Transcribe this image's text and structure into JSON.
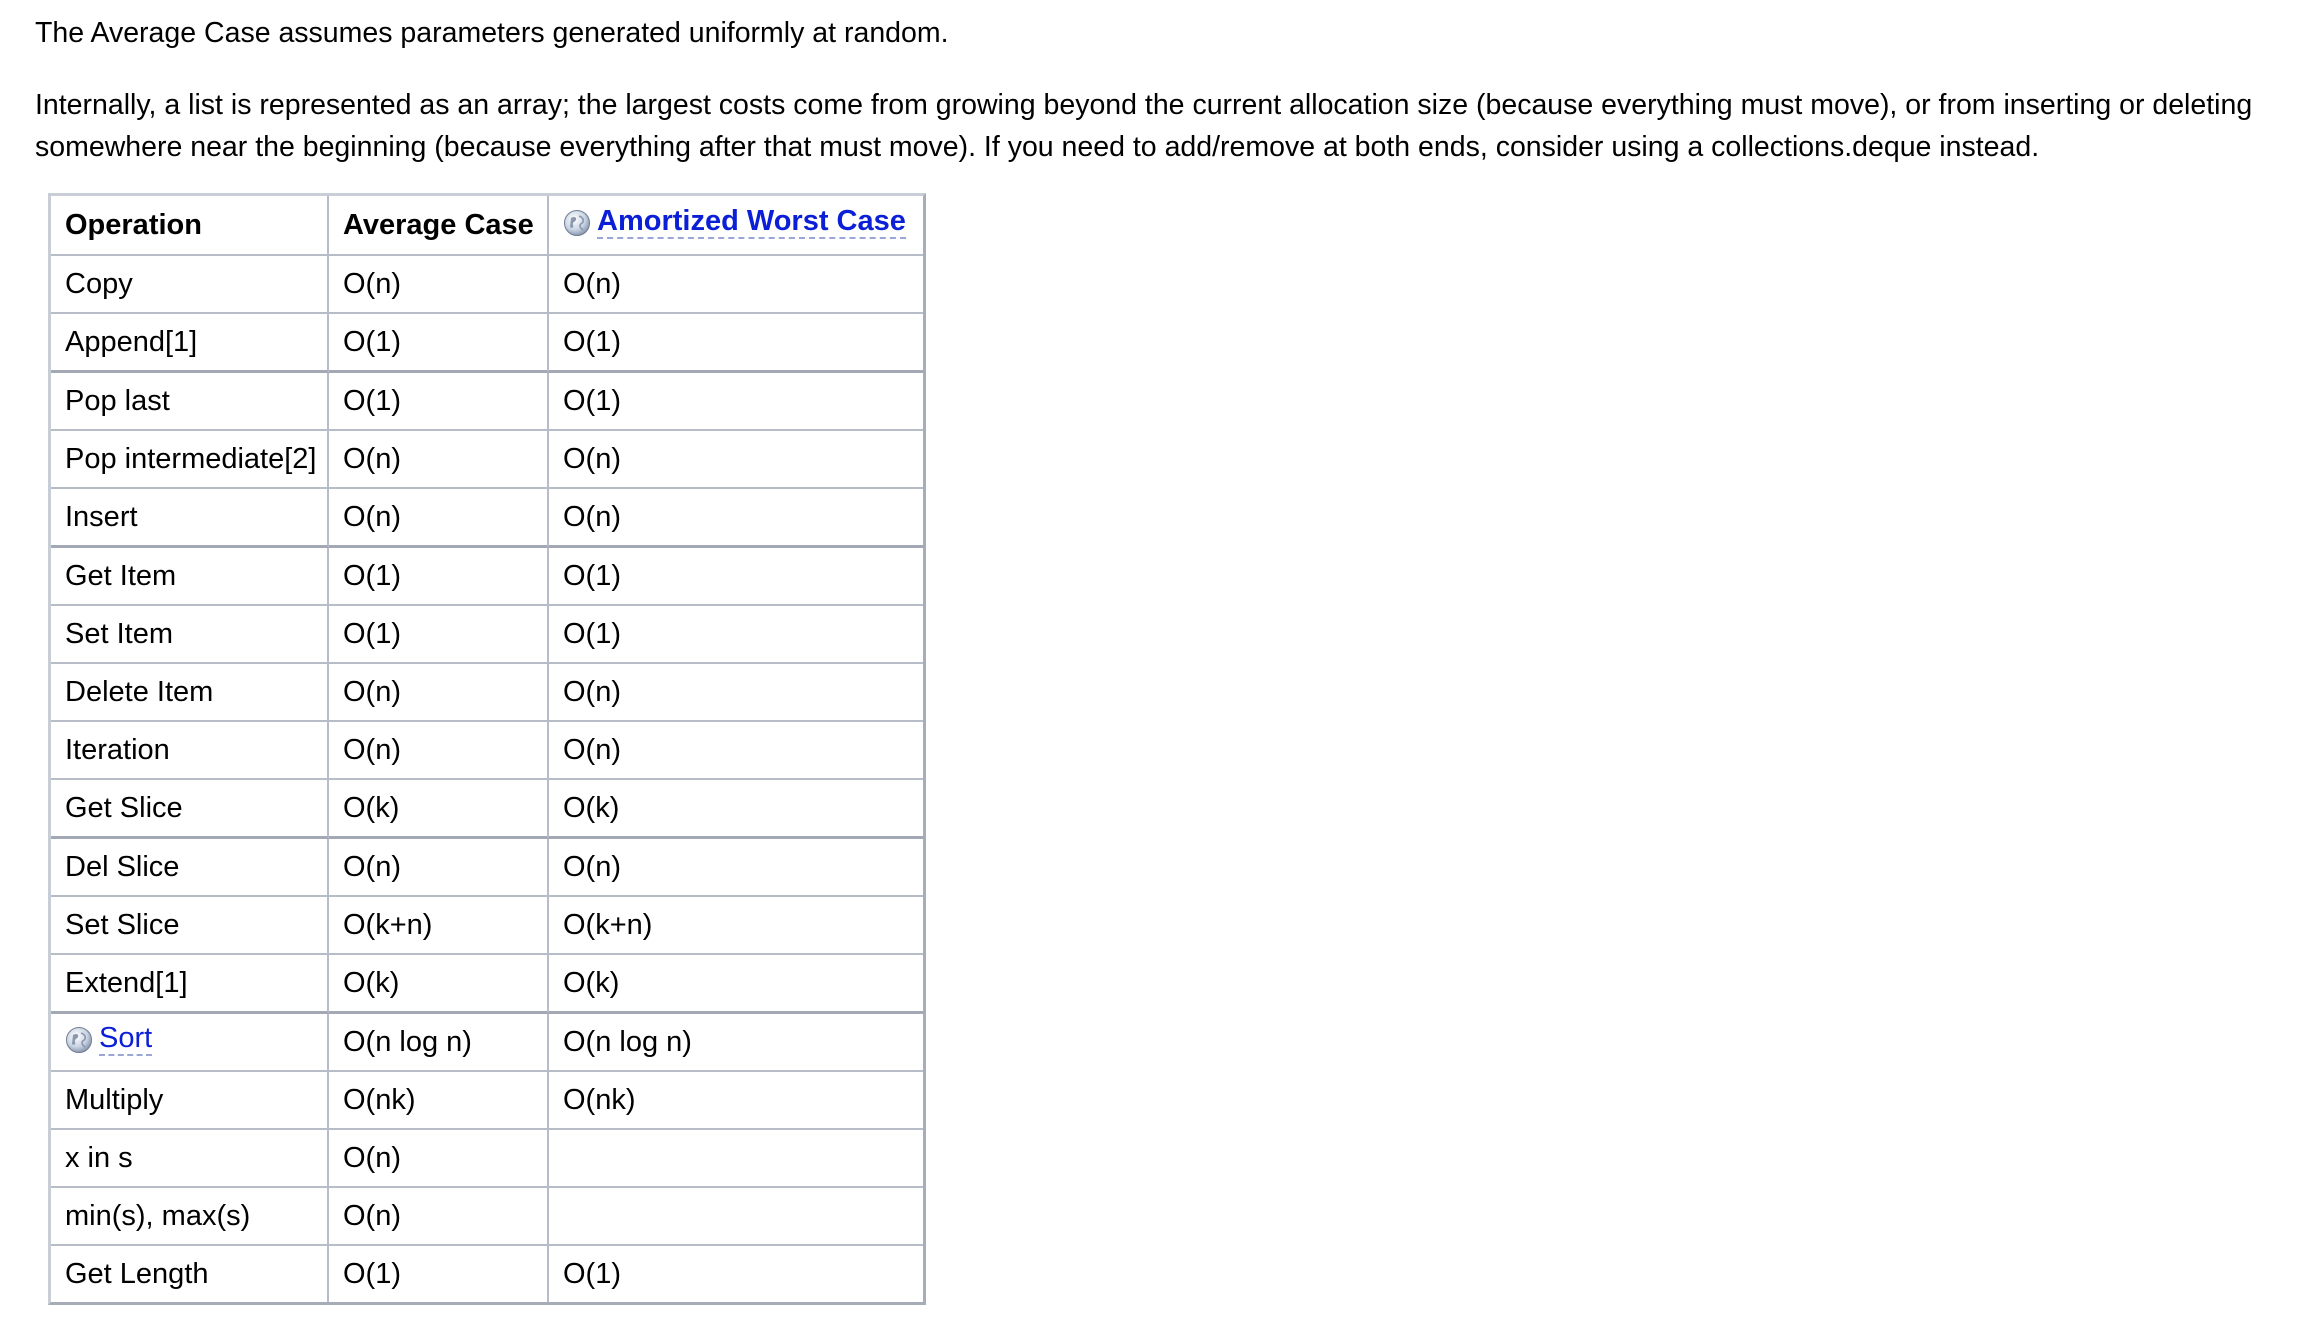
{
  "intro": "The Average Case assumes parameters generated uniformly at random.",
  "paragraph": {
    "line1": "Internally, a list is represented as an array; the largest costs come from growing beyond the current allocation size (because everything must move), or from inserting or deleting",
    "line2": "somewhere near the beginning (because everything after that must move). If you need to add/remove at both ends, consider using a collections.deque instead."
  },
  "table": {
    "headers": {
      "operation": "Operation",
      "average": "Average Case",
      "worst": "Amortized Worst Case"
    },
    "header_icons": {
      "worst": "wiki-globe-icon"
    },
    "rows": [
      {
        "operation": "Copy",
        "average": "O(n)",
        "worst": "O(n)"
      },
      {
        "operation": "Append[1]",
        "average": "O(1)",
        "worst": "O(1)"
      },
      {
        "operation": "Pop last",
        "average": "O(1)",
        "worst": "O(1)"
      },
      {
        "operation": "Pop intermediate[2]",
        "average": "O(n)",
        "worst": "O(n)"
      },
      {
        "operation": "Insert",
        "average": "O(n)",
        "worst": "O(n)"
      },
      {
        "operation": "Get Item",
        "average": "O(1)",
        "worst": "O(1)"
      },
      {
        "operation": "Set Item",
        "average": "O(1)",
        "worst": "O(1)"
      },
      {
        "operation": "Delete Item",
        "average": "O(n)",
        "worst": "O(n)"
      },
      {
        "operation": "Iteration",
        "average": "O(n)",
        "worst": "O(n)"
      },
      {
        "operation": "Get Slice",
        "average": "O(k)",
        "worst": "O(k)"
      },
      {
        "operation": "Del Slice",
        "average": "O(n)",
        "worst": "O(n)"
      },
      {
        "operation": "Set Slice",
        "average": "O(k+n)",
        "worst": "O(k+n)"
      },
      {
        "operation": "Extend[1]",
        "average": "O(k)",
        "worst": "O(k)"
      },
      {
        "operation": "Sort",
        "average": "O(n log n)",
        "worst": "O(n log n)",
        "link": true,
        "icon": "wiki-globe-icon"
      },
      {
        "operation": "Multiply",
        "average": "O(nk)",
        "worst": "O(nk)"
      },
      {
        "operation": "x in s",
        "average": "O(n)",
        "worst": ""
      },
      {
        "operation": "min(s), max(s)",
        "average": "O(n)",
        "worst": ""
      },
      {
        "operation": "Get Length",
        "average": "O(1)",
        "worst": "O(1)"
      }
    ]
  },
  "colors": {
    "link": "#0b1fd6",
    "table_border": "#b6bcc8"
  }
}
